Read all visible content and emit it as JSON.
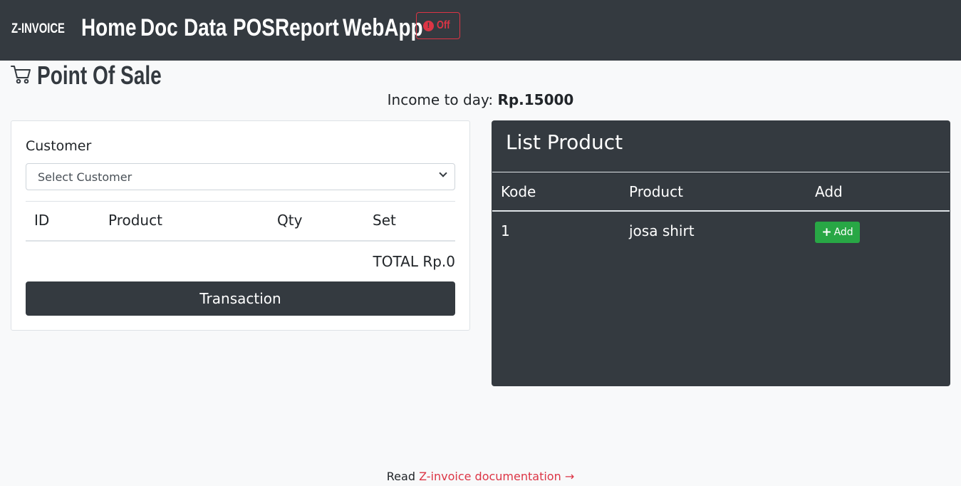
{
  "navbar": {
    "brand": "Z-INVOICE",
    "links": [
      "Home",
      "Doc",
      "Data",
      "POS",
      "Report",
      "WebApp"
    ],
    "status_button": {
      "icon": "alert-circle-icon",
      "label": "Off",
      "color": "#dc3545"
    }
  },
  "page": {
    "title_icon": "cart-icon",
    "title": "Point Of Sale",
    "income_label": "Income to day: ",
    "income_value": "Rp.15000"
  },
  "cart": {
    "customer_label": "Customer",
    "customer_select": "Select Customer",
    "columns": [
      "ID",
      "Product",
      "Qty",
      "Set"
    ],
    "total": "TOTAL Rp.0",
    "transaction_button": "Transaction"
  },
  "product_list": {
    "header": "List Product",
    "columns": [
      "Kode",
      "Product",
      "Add"
    ],
    "rows": [
      {
        "kode": "1",
        "product": "josa shirt",
        "add_label": "Add"
      }
    ]
  },
  "footer": {
    "prefix": "Read ",
    "link_text": "Z-invoice documentation →"
  },
  "colors": {
    "navbar_bg": "#343a40",
    "danger": "#dc3545",
    "success": "#28a745"
  }
}
